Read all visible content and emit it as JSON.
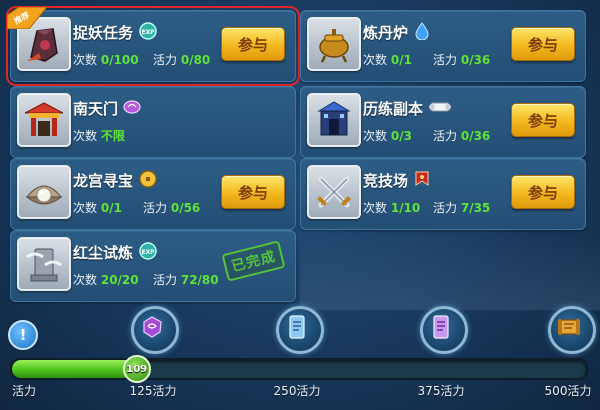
{
  "activities": [
    {
      "id": "catch-demon",
      "title": "捉妖任务",
      "badge": "exp-icon",
      "times_label": "次数",
      "times": "0/100",
      "vitality_label": "活力",
      "vitality": "0/80",
      "action": "参与",
      "corner_flag": "推荐",
      "icon": "demon-relic-icon"
    },
    {
      "id": "alchemy",
      "title": "炼丹炉",
      "badge": "water-drop-icon",
      "times_label": "次数",
      "times": "0/1",
      "vitality_label": "活力",
      "vitality": "0/36",
      "action": "参与",
      "icon": "cauldron-icon"
    },
    {
      "id": "south-gate",
      "title": "南天门",
      "badge": "purple-gem-icon",
      "times_label": "次数",
      "times": "不限",
      "vitality_label": "",
      "vitality": "",
      "action": "",
      "icon": "gate-icon"
    },
    {
      "id": "training-dungeon",
      "title": "历练副本",
      "badge": "scroll-icon",
      "times_label": "次数",
      "times": "0/3",
      "vitality_label": "活力",
      "vitality": "0/36",
      "action": "参与",
      "icon": "tower-icon"
    },
    {
      "id": "dragon-treasure",
      "title": "龙宫寻宝",
      "badge": "coin-icon",
      "times_label": "次数",
      "times": "0/1",
      "vitality_label": "活力",
      "vitality": "0/56",
      "action": "参与",
      "icon": "pearl-shell-icon"
    },
    {
      "id": "arena",
      "title": "竞技场",
      "badge": "red-banner-icon",
      "times_label": "次数",
      "times": "1/10",
      "vitality_label": "活力",
      "vitality": "7/35",
      "action": "参与",
      "icon": "crossed-swords-icon"
    },
    {
      "id": "red-dust-trial",
      "title": "红尘试炼",
      "badge": "exp-icon",
      "times_label": "次数",
      "times": "20/20",
      "vitality_label": "活力",
      "vitality": "72/80",
      "action": "",
      "stamp": "已完成",
      "icon": "stone-pillar-icon"
    }
  ],
  "progress": {
    "start_label": "活力",
    "current": 109,
    "max": 500,
    "milestones": [
      {
        "value": 125,
        "label": "125活力",
        "reward": "purple-stone-icon"
      },
      {
        "value": 250,
        "label": "250活力",
        "reward": "blue-talisman-icon"
      },
      {
        "value": 375,
        "label": "375活力",
        "reward": "purple-talisman-icon"
      },
      {
        "value": 500,
        "label": "500活力",
        "reward": "scroll-chest-icon"
      }
    ]
  },
  "colors": {
    "value_green": "#5fe23a",
    "button_gold": "#f3b81e",
    "highlight_red": "#e2262a"
  }
}
